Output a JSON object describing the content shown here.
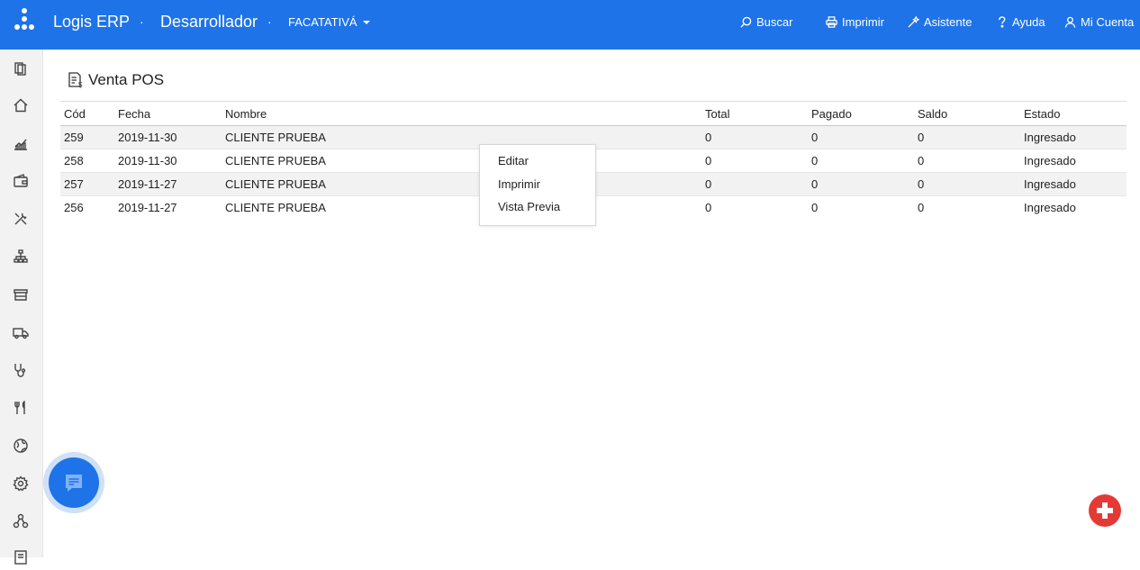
{
  "header": {
    "brand": "Logis ERP",
    "separator": "·",
    "user_role": "Desarrollador",
    "branch": "FACATATIVÁ",
    "nav": {
      "search": "Buscar",
      "print": "Imprimir",
      "assistant": "Asistente",
      "help": "Ayuda",
      "account": "Mi Cuenta"
    }
  },
  "sidebar": {
    "icons": [
      "documents-icon",
      "home-icon",
      "chart-icon",
      "wallet-icon",
      "tools-icon",
      "hierarchy-icon",
      "store-icon",
      "truck-icon",
      "stethoscope-icon",
      "restaurant-icon",
      "globe-icon",
      "gear-icon",
      "network-icon",
      "report-icon"
    ]
  },
  "page": {
    "title": "Venta POS"
  },
  "table": {
    "columns": {
      "cod": "Cód",
      "fecha": "Fecha",
      "nombre": "Nombre",
      "total": "Total",
      "pagado": "Pagado",
      "saldo": "Saldo",
      "estado": "Estado"
    },
    "rows": [
      {
        "cod": "259",
        "fecha": "2019-11-30",
        "nombre": "CLIENTE PRUEBA",
        "total": "0",
        "pagado": "0",
        "saldo": "0",
        "estado": "Ingresado"
      },
      {
        "cod": "258",
        "fecha": "2019-11-30",
        "nombre": "CLIENTE PRUEBA",
        "total": "0",
        "pagado": "0",
        "saldo": "0",
        "estado": "Ingresado"
      },
      {
        "cod": "257",
        "fecha": "2019-11-27",
        "nombre": "CLIENTE PRUEBA",
        "total": "0",
        "pagado": "0",
        "saldo": "0",
        "estado": "Ingresado"
      },
      {
        "cod": "256",
        "fecha": "2019-11-27",
        "nombre": "CLIENTE PRUEBA",
        "total": "0",
        "pagado": "0",
        "saldo": "0",
        "estado": "Ingresado"
      }
    ]
  },
  "context_menu": {
    "edit": "Editar",
    "print": "Imprimir",
    "preview": "Vista Previa"
  },
  "colors": {
    "topbar": "#1e73e8",
    "add_button": "#e53935"
  }
}
